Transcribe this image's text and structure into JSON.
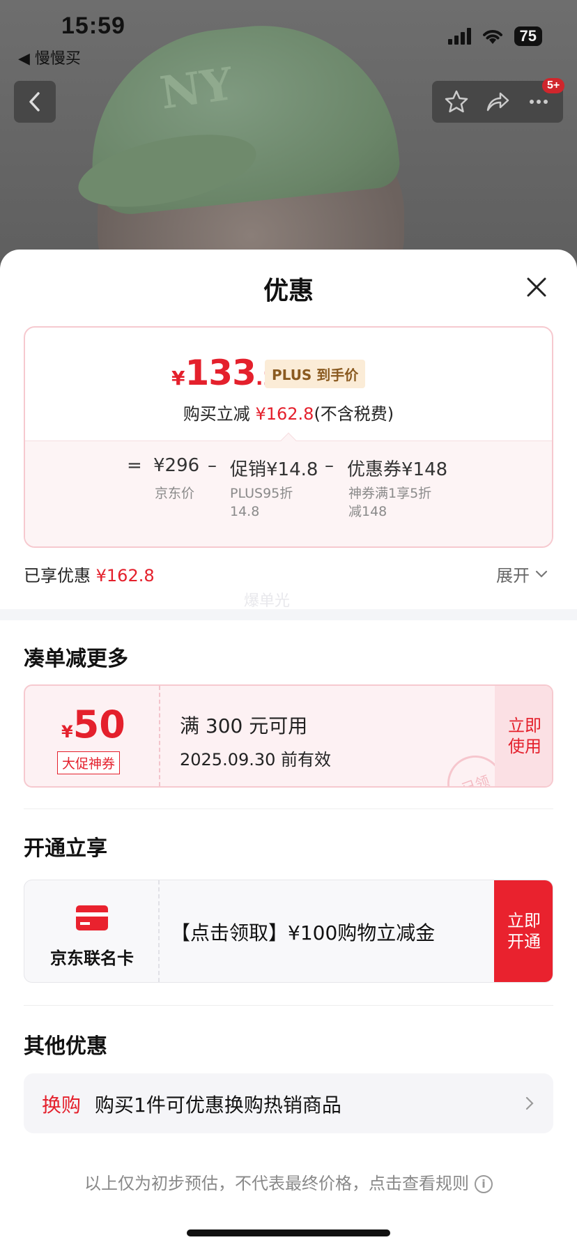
{
  "status_bar": {
    "time": "15:59",
    "back_app": "◀ 慢慢买",
    "battery": "75"
  },
  "nav": {
    "badge": "5+"
  },
  "sheet": {
    "title": "优惠",
    "price": {
      "currency": "¥",
      "integer": "133",
      "decimal": ".2",
      "tag": "PLUS 到手价",
      "reduce_prefix": "购买立减 ",
      "reduce_amount": "¥162.8",
      "reduce_suffix": "(不含税费)",
      "formula": {
        "eq": "=",
        "jd_price": "¥296",
        "minus1": "–",
        "promo": "促销¥14.8",
        "minus2": "–",
        "coupon": "优惠券¥148",
        "jd_price_label": "京东价",
        "promo_note_1": "PLUS95折",
        "promo_note_2": "14.8",
        "coupon_note_1": "神券满1享5折",
        "coupon_note_2": "减148"
      }
    },
    "enjoyed_label": "已享优惠 ",
    "enjoyed_amount": "¥162.8",
    "expand_label": "展开",
    "watermark": "爆单光"
  },
  "more_section": {
    "title": "凑单减更多",
    "coupon": {
      "currency": "¥",
      "amount": "50",
      "tag": "大促神券",
      "condition": "满 300 元可用",
      "validity": "2025.09.30 前有效",
      "button": "立即\n使用",
      "stamp": "已领"
    }
  },
  "open_section": {
    "title": "开通立享",
    "card_name": "京东联名卡",
    "text": "【点击领取】¥100购物立减金",
    "button": "立即\n开通"
  },
  "other_section": {
    "title": "其他优惠",
    "tag": "换购",
    "text": "购买1件可优惠换购热销商品"
  },
  "disclaimer": "以上仅为初步预估，不代表最终价格，点击查看规则",
  "colors": {
    "accent_red": "#e4202c",
    "card_red": "#e9222e",
    "plus_gold_bg": "#fbecd7"
  }
}
